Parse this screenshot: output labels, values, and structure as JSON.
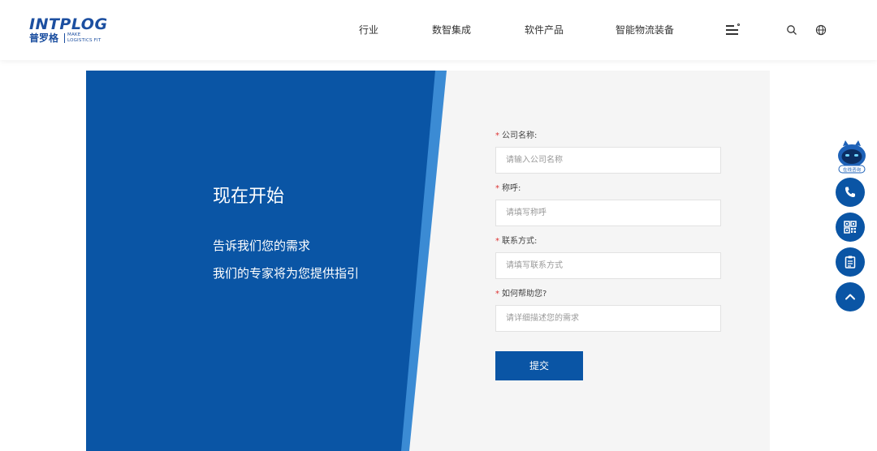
{
  "brand": {
    "logo_text": "INTPLOG",
    "logo_cn": "普罗格",
    "tagline_line1": "MAKE",
    "tagline_line2": "LOGISTICS FIT"
  },
  "nav": {
    "items": [
      {
        "label": "行业"
      },
      {
        "label": "数智集成"
      },
      {
        "label": "软件产品"
      },
      {
        "label": "智能物流装备"
      }
    ],
    "icons": [
      "menu-icon",
      "search-icon",
      "globe-icon"
    ]
  },
  "hero": {
    "title": "现在开始",
    "line1": "告诉我们您的需求",
    "line2": "我们的专家将为您提供指引"
  },
  "form": {
    "required_mark": "*",
    "fields": [
      {
        "label": "公司名称:",
        "placeholder": "请输入公司名称"
      },
      {
        "label": "称呼:",
        "placeholder": "请填写称呼"
      },
      {
        "label": "联系方式:",
        "placeholder": "请填写联系方式"
      },
      {
        "label": "如何帮助您?",
        "placeholder": "请详细描述您的需求"
      }
    ],
    "submit_label": "提交"
  },
  "floating": {
    "robot_label": "在线咨询",
    "buttons": [
      "phone-icon",
      "qrcode-icon",
      "clipboard-icon",
      "chevron-up-icon"
    ]
  },
  "colors": {
    "brand_blue": "#0a55a5",
    "accent_blue": "#3b8bd4",
    "logo_blue": "#1c4fa0",
    "panel_bg": "#f5f5f5",
    "required_red": "#dd3333"
  }
}
